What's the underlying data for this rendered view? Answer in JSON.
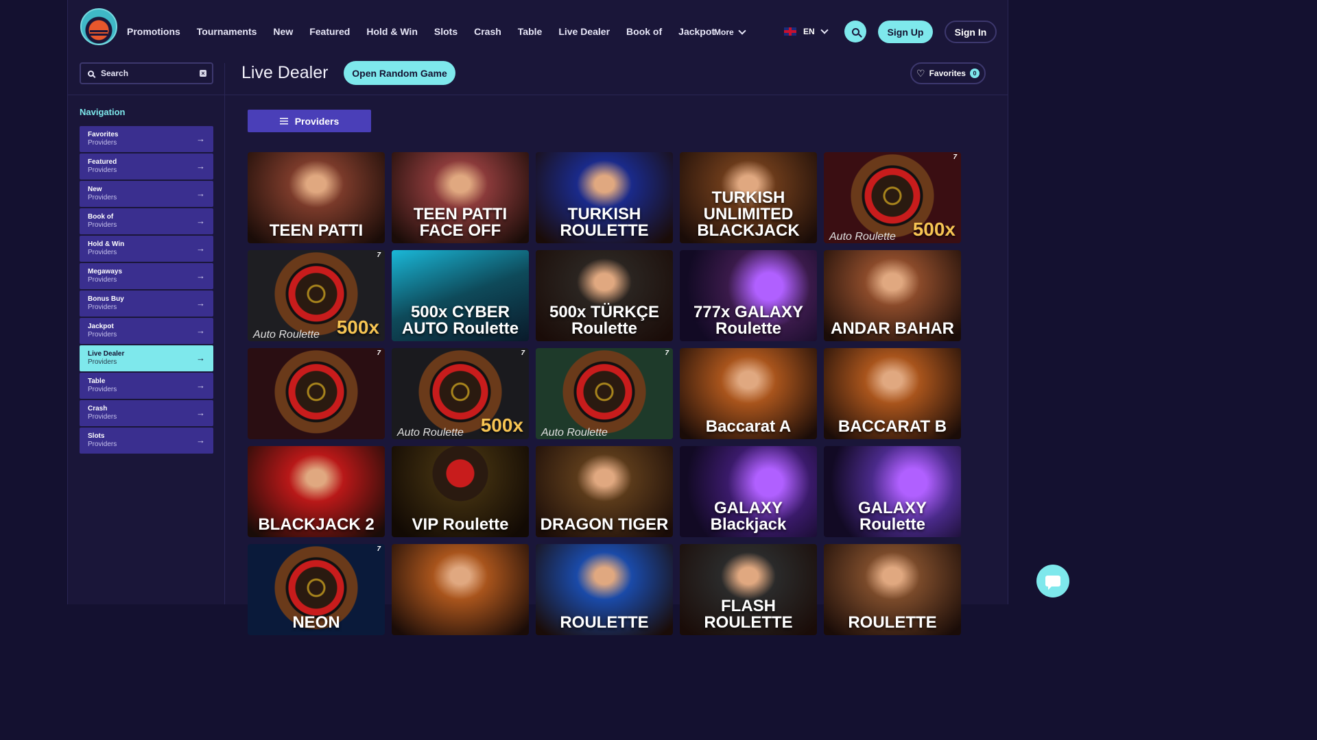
{
  "nav": {
    "links": [
      "Promotions",
      "Tournaments",
      "New",
      "Featured",
      "Hold & Win",
      "Slots",
      "Crash",
      "Table",
      "Live Dealer",
      "Book of",
      "Jackpot"
    ],
    "more": "More",
    "language": "EN",
    "signup": "Sign Up",
    "signin": "Sign In"
  },
  "search": {
    "placeholder": "Search"
  },
  "page": {
    "title": "Live Dealer",
    "random_button": "Open Random Game",
    "favorites_label": "Favorites",
    "favorites_count": "0",
    "providers_button": "Providers"
  },
  "sidebar": {
    "title": "Navigation",
    "items": [
      {
        "label": "Favorites",
        "sub": "Providers",
        "active": false
      },
      {
        "label": "Featured",
        "sub": "Providers",
        "active": false
      },
      {
        "label": "New",
        "sub": "Providers",
        "active": false
      },
      {
        "label": "Book of",
        "sub": "Providers",
        "active": false
      },
      {
        "label": "Hold & Win",
        "sub": "Providers",
        "active": false
      },
      {
        "label": "Megaways",
        "sub": "Providers",
        "active": false
      },
      {
        "label": "Bonus Buy",
        "sub": "Providers",
        "active": false
      },
      {
        "label": "Jackpot",
        "sub": "Providers",
        "active": false
      },
      {
        "label": "Live Dealer",
        "sub": "Providers",
        "active": true
      },
      {
        "label": "Table",
        "sub": "Providers",
        "active": false
      },
      {
        "label": "Crash",
        "sub": "Providers",
        "active": false
      },
      {
        "label": "Slots",
        "sub": "Providers",
        "active": false
      }
    ]
  },
  "games": [
    {
      "title": "TEEN PATTI",
      "style": "dealers",
      "bg": "#7a3a2a"
    },
    {
      "title": "TEEN PATTI FACE OFF",
      "style": "dealers",
      "bg": "#8a3a3a"
    },
    {
      "title": "TURKISH ROULETTE",
      "style": "dealers",
      "bg": "#1a2a8a"
    },
    {
      "title": "TURKISH UNLIMITED BLACKJACK",
      "style": "dealers",
      "bg": "#6a3a1a"
    },
    {
      "title": "",
      "style": "wheel",
      "bg": "#3a0e12",
      "mult": "500x",
      "auto": "Auto Roulette"
    },
    {
      "title": "",
      "style": "wheel",
      "bg": "#1e1e22",
      "mult": "500x",
      "auto": "Auto Roulette"
    },
    {
      "title": "500x CYBER AUTO Roulette",
      "style": "cyber",
      "bg": "#0e4a5a"
    },
    {
      "title": "500x TÜRKÇE Roulette",
      "style": "dealers",
      "bg": "#2a2420"
    },
    {
      "title": "777x GALAXY Roulette",
      "style": "galaxy",
      "bg": "#3a1a4a"
    },
    {
      "title": "ANDAR BAHAR",
      "style": "dealers",
      "bg": "#8a4a2a"
    },
    {
      "title": "",
      "style": "wheel",
      "bg": "#2a0e12",
      "mult": "",
      "auto": ""
    },
    {
      "title": "",
      "style": "wheel",
      "bg": "#1a1a1e",
      "mult": "500x",
      "auto": "Auto Roulette"
    },
    {
      "title": "",
      "style": "wheel",
      "bg": "#1e3a2a",
      "mult": "",
      "auto": "Auto Roulette"
    },
    {
      "title": "Baccarat A",
      "style": "dealers",
      "bg": "#a8541c"
    },
    {
      "title": "BACCARAT B",
      "style": "dealers",
      "bg": "#a8541c"
    },
    {
      "title": "BLACKJACK 2",
      "style": "dealers",
      "bg": "#b81818"
    },
    {
      "title": "VIP Roulette",
      "style": "vip",
      "bg": "#3a2a0e"
    },
    {
      "title": "DRAGON TIGER",
      "style": "dealers",
      "bg": "#5a3a1a"
    },
    {
      "title": "GALAXY Blackjack",
      "style": "galaxy",
      "bg": "#3a1a6a"
    },
    {
      "title": "GALAXY Roulette",
      "style": "galaxy",
      "bg": "#4a2a8a"
    },
    {
      "title": "NEON",
      "style": "wheel",
      "bg": "#0a1a3a",
      "mult": "",
      "auto": ""
    },
    {
      "title": "",
      "style": "dealers",
      "bg": "#a8541c"
    },
    {
      "title": "ROULETTE",
      "style": "dealers",
      "bg": "#1a4aa8"
    },
    {
      "title": "FLASH ROULETTE",
      "style": "dealers",
      "bg": "#2a2a2a"
    },
    {
      "title": "ROULETTE",
      "style": "dealers",
      "bg": "#7a4a2a"
    }
  ]
}
